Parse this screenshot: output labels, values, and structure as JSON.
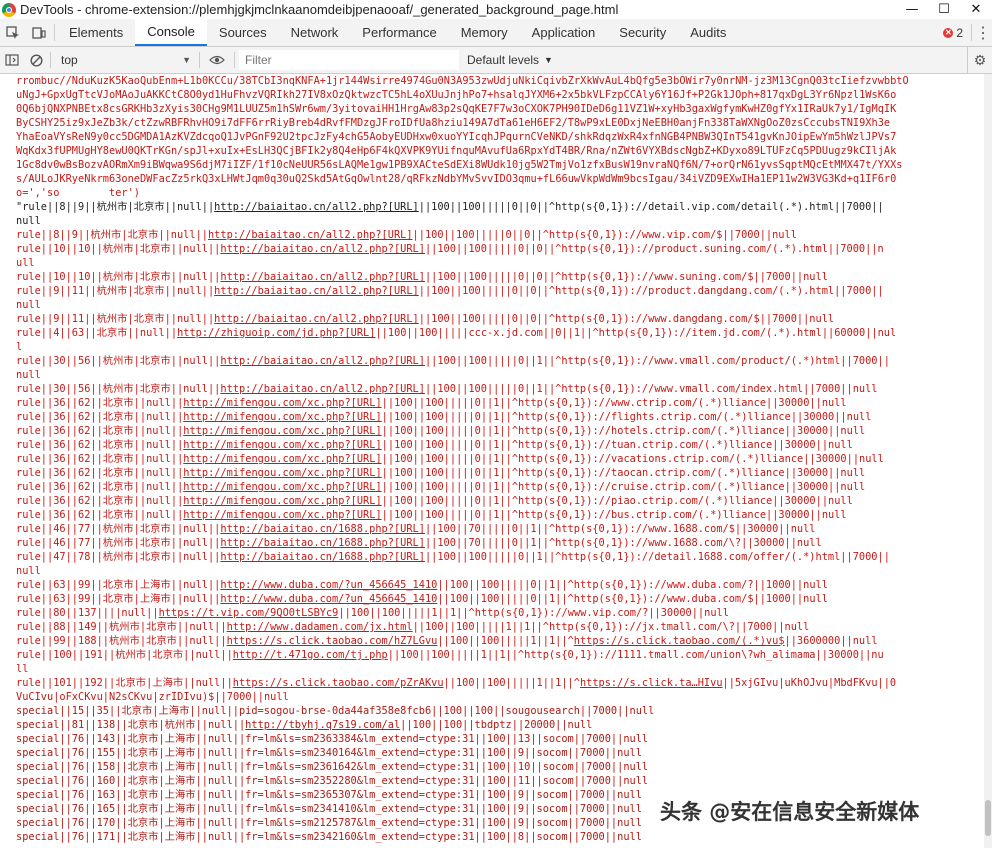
{
  "window": {
    "title": "DevTools - chrome-extension://plemhjgkjmclnkaanomdeibjpenaooaf/_generated_background_page.html",
    "controls": [
      "—",
      "☐",
      "✕"
    ]
  },
  "tabs": [
    {
      "label": "Elements"
    },
    {
      "label": "Console",
      "active": true
    },
    {
      "label": "Sources"
    },
    {
      "label": "Network"
    },
    {
      "label": "Performance"
    },
    {
      "label": "Memory"
    },
    {
      "label": "Application"
    },
    {
      "label": "Security"
    },
    {
      "label": "Audits"
    }
  ],
  "error_count": "2",
  "toolbar": {
    "context": "top",
    "filter_placeholder": "Filter",
    "levels": "Default levels"
  },
  "colors": {
    "error_text": "#c41a16",
    "active_tab": "#1a73e8"
  },
  "console": {
    "blob": [
      "rrombuc//NduKuzK5KaoQubEnm+L1b0KCCu/38TCbI3nqKNFA+1jr144Wsirre4974Gu0N3A953zwUdjuNkiCqivbZrXkWvAuL4bQfg5e3bOWir7y0nrNM-jz3M13CgnQ03tcIiefzvwbbtO",
      "uNgJ+GpxUgTtcVJoMAoJuAKKCtC8O0yd1HuFhvzVQRIkh27IV8xOzQktwzcTC5hL4oXUuJnjhPo7+hsalqJYXM6+2x5bkVLFzpCCAly6Y16Jf+P2Gk1JOph+817qxDgL3Yr6Npzl1WsK6o",
      "0Q6bjQNXPNBEtx8csGRKHb3zXyis30CHg9M1LUUZ5m1hSWr6wm/3yitovaiHH1HrgAw83p2sQqKE7F7w3oCXOK7PH90IDeD6g11VZ1W+xyHb3gaxWgfymKwHZ0gfYx1IRaUk7y1/IgMqIK",
      "ByCSHY25iz9xJeZb3k/ctZzwRBFRhvHO9i7dFF6rrRiyBreb4dRvfFMDzgJFroIDfUa8hziu149A7dTa61eH6EF2/T8wP9xLE0DxjNeEBH0anjFn338TaWXNgOoZ0zsCccubsTNI9Xh3e",
      "YhaEoaVYsReN9y0cc5DGMDA1AzKVZdcqoQ1JvPGnF92U2tpcJzFy4chG5AobyEUDHxw0xuoYYIcqhJPqurnCVeNKD/shkRdqzWxR4xfnNGB4PNBW3QInT541gvKnJOipEwYm5hWzlJPVs7",
      "WqKdx3fUPMUgHY8ewU0QKTrKGn/spJl+xuIx+EsLH3QCjBFIk2y8Q4eHp6F4kQXVPK9YUifnquMAvufUa6RpxYdT4BR/Rna/nZWt6VYXBdscNgbZ+KDyxo89LTUFzCq5PDUugz9kCIljAk",
      "1Gc8dv0wBsBozvAORmXm9iBWqwa9S6djM7iIZF/1f10cNeUUR56sLAQMe1gw1PB9XACteSdEXi8WUdk10jg5W2TmjVo1zfxBusW19nvraNQf6N/7+orQrN61yvsSqptMQcEtMMX47t/YXXs",
      "s/AULoJKRyeNkrm63oneDWFacZz5rkQ3xLHWtJqm0q30uQ2Skd5AtGqOwlnt28/qRFkzNdbYMvSvvIDO3qmu+fL66uwVkpWdWm9bcsIgau/34iVZD9EXwIHa1EP11w2W3VG3Kd+q1IF6r0",
      "o=','so        ter')"
    ],
    "lines": [
      {
        "t": "\"rule||8||9||杭州市|北京市||null||http://baiaitao.cn/all2.php?[URL]||100||100|||||0||0||^http(s{0,1})://detail.vip.com/detail(.*).html||7000||",
        "c": "black"
      },
      {
        "t": "null",
        "c": "black"
      },
      {
        "t": "rule||8||9||杭州市|北京市||null||http://baiaitao.cn/all2.php?[URL]||100||100|||||0||0||^http(s{0,1})://www.vip.com/$||7000||null"
      },
      {
        "t": "rule||10||10||杭州市|北京市||null||http://baiaitao.cn/all2.php?[URL]||100||100|||||0||0||^http(s{0,1})://product.suning.com/(.*).html||7000||n"
      },
      {
        "t": "ull"
      },
      {
        "t": "rule||10||10||杭州市|北京市||null||http://baiaitao.cn/all2.php?[URL]||100||100|||||0||0||^http(s{0,1})://www.suning.com/$||7000||null"
      },
      {
        "t": "rule||9||11||杭州市|北京市||null||http://baiaitao.cn/all2.php?[URL]||100||100|||||0||0||^http(s{0,1})://product.dangdang.com/(.*).html||7000||"
      },
      {
        "t": "null"
      },
      {
        "t": "rule||9||11||杭州市|北京市||null||http://baiaitao.cn/all2.php?[URL]||100||100|||||0||0||^http(s{0,1})://www.dangdang.com/$||7000||null"
      },
      {
        "t": "rule||4||63||北京市||null||http://zhiguoip.com/jd.php?[URL]||100||100|||||ccc-x.jd.com||0||1||^http(s{0,1})://item.jd.com/(.*).html||60000||nul"
      },
      {
        "t": "l"
      },
      {
        "t": "rule||30||56||杭州市|北京市||null||http://baiaitao.cn/all2.php?[URL]||100||100|||||0||1||^http(s{0,1})://www.vmall.com/product/(.*)html||7000||"
      },
      {
        "t": "null"
      },
      {
        "t": "rule||30||56||杭州市|北京市||null||http://baiaitao.cn/all2.php?[URL]||100||100|||||0||1||^http(s{0,1})://www.vmall.com/index.html||7000||null"
      },
      {
        "t": "rule||36||62||北京市||null||http://mifengou.com/xc.php?[URL]||100||100|||||0||1||^http(s{0,1})://www.ctrip.com/(.*)lliance||30000||null"
      },
      {
        "t": "rule||36||62||北京市||null||http://mifengou.com/xc.php?[URL]||100||100|||||0||1||^http(s{0,1})://flights.ctrip.com/(.*)lliance||30000||null"
      },
      {
        "t": "rule||36||62||北京市||null||http://mifengou.com/xc.php?[URL]||100||100|||||0||1||^http(s{0,1})://hotels.ctrip.com/(.*)lliance||30000||null"
      },
      {
        "t": "rule||36||62||北京市||null||http://mifengou.com/xc.php?[URL]||100||100|||||0||1||^http(s{0,1})://tuan.ctrip.com/(.*)lliance||30000||null"
      },
      {
        "t": "rule||36||62||北京市||null||http://mifengou.com/xc.php?[URL]||100||100|||||0||1||^http(s{0,1})://vacations.ctrip.com/(.*)lliance||30000||null"
      },
      {
        "t": "rule||36||62||北京市||null||http://mifengou.com/xc.php?[URL]||100||100|||||0||1||^http(s{0,1})://taocan.ctrip.com/(.*)lliance||30000||null"
      },
      {
        "t": "rule||36||62||北京市||null||http://mifengou.com/xc.php?[URL]||100||100|||||0||1||^http(s{0,1})://cruise.ctrip.com/(.*)lliance||30000||null"
      },
      {
        "t": "rule||36||62||北京市||null||http://mifengou.com/xc.php?[URL]||100||100|||||0||1||^http(s{0,1})://piao.ctrip.com/(.*)lliance||30000||null"
      },
      {
        "t": "rule||36||62||北京市||null||http://mifengou.com/xc.php?[URL]||100||100|||||0||1||^http(s{0,1})://bus.ctrip.com/(.*)lliance||30000||null"
      },
      {
        "t": "rule||46||77||杭州市|北京市||null||http://baiaitao.cn/1688.php?[URL]||100||70|||||0||1||^http(s{0,1})://www.1688.com/$||30000||null"
      },
      {
        "t": "rule||46||77||杭州市|北京市||null||http://baiaitao.cn/1688.php?[URL]||100||70|||||0||1||^http(s{0,1})://www.1688.com/\\?||30000||null"
      },
      {
        "t": "rule||47||78||杭州市|北京市||null||http://baiaitao.cn/1688.php?[URL]||100||100|||||0||1||^http(s{0,1})://detail.1688.com/offer/(.*)html||7000||"
      },
      {
        "t": "null"
      },
      {
        "t": "rule||63||99||北京市|上海市||null||http://www.duba.com/?un_456645_1410||100||100|||||0||1||^http(s{0,1})://www.duba.com/?||1000||null"
      },
      {
        "t": "rule||63||99||北京市|上海市||null||http://www.duba.com/?un_456645_1410||100||100|||||0||1||^http(s{0,1})://www.duba.com/$||1000||null"
      },
      {
        "t": "rule||80||137||||null||https://t.vip.com/9QO0tLSBYc9||100||100|||||1||1||^http(s{0,1})://www.vip.com/?||30000||null"
      },
      {
        "t": "rule||88||149||杭州市|北京市||null||http://www.dadamen.com/jx.html||100||100|||||1||1||^http(s{0,1})://jx.tmall.com/\\?||7000||null"
      },
      {
        "t": "rule||99||188||杭州市|北京市||null||https://s.click.taobao.com/hZ7LGvu||100||100|||||1||1||^https://s.click.taobao.com/(.*)vu$||3600000||null"
      },
      {
        "t": "rule||100||191||杭州市|北京市||null||http://t.471go.com/tj.php||100||100|||||1||1||^http(s{0,1})://1111.tmall.com/union\\?wh_alimama||30000||nu"
      },
      {
        "t": "ll"
      },
      {
        "t": "rule||101||192||北京市|上海市||null||https://s.click.taobao.com/pZrAKvu||100||100|||||1||1||^https://s.click.ta…HIvu||5xjGIvu|uKhOJvu|MbdFKvu||0"
      },
      {
        "t": "VuCIvu|oFxCKvu|N2sCKvu|zrIDIvu)$||7000||null"
      },
      {
        "t": "special||15||35||北京市|上海市||null||pid=sogou-brse-0da44af358e8fcb6||100||100||sougousearch||7000||null",
        "c": "dark"
      },
      {
        "t": "special||81||138||北京市|杭州市||null||http://tbyhj.q7s19.com/al||100||100||tbdptz||20000||null",
        "c": "dark"
      },
      {
        "t": "special||76||143||北京市|上海市||null||fr=lm&ls=sm2363384&lm_extend=ctype:31||100||13||socom||7000||null",
        "c": "dark"
      },
      {
        "t": "special||76||155||北京市|上海市||null||fr=lm&ls=sm2340164&lm_extend=ctype:31||100||9||socom||7000||null",
        "c": "dark"
      },
      {
        "t": "special||76||158||北京市|上海市||null||fr=lm&ls=sm2361642&lm_extend=ctype:31||100||10||socom||7000||null",
        "c": "dark"
      },
      {
        "t": "special||76||160||北京市|上海市||null||fr=lm&ls=sm2352280&lm_extend=ctype:31||100||11||socom||7000||null",
        "c": "dark"
      },
      {
        "t": "special||76||163||北京市|上海市||null||fr=lm&ls=sm2365307&lm_extend=ctype:31||100||9||socom||7000||null",
        "c": "dark"
      },
      {
        "t": "special||76||165||北京市|上海市||null||fr=lm&ls=sm2341410&lm_extend=ctype:31||100||9||socom||7000||null",
        "c": "dark"
      },
      {
        "t": "special||76||170||北京市|上海市||null||fr=lm&ls=sm2125787&lm_extend=ctype:31||100||9||socom||7000||null",
        "c": "dark"
      },
      {
        "t": "special||76||171||北京市|上海市||null||fr=lm&ls=sm2342160&lm_extend=ctype:31||100||8||socom||7000||null",
        "c": "dark"
      }
    ]
  },
  "watermark": "头条 @安在信息安全新媒体"
}
